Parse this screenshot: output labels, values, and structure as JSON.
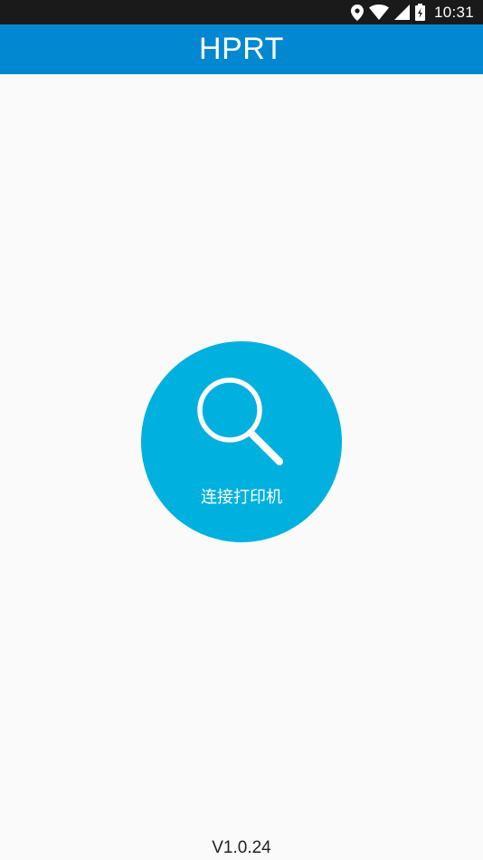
{
  "status_bar": {
    "time": "10:31",
    "icons": [
      "location-icon",
      "wifi-icon",
      "signal-icon",
      "battery-icon"
    ]
  },
  "app_bar": {
    "title": "HPRT"
  },
  "main": {
    "connect_button": {
      "label": "连接打印机",
      "icon": "search-icon"
    }
  },
  "footer": {
    "version": "V1.0.24"
  },
  "colors": {
    "status_bar": "#1a1a1a",
    "app_bar": "#0288d1",
    "connect_button": "#00b0de",
    "background": "#fafafa"
  }
}
